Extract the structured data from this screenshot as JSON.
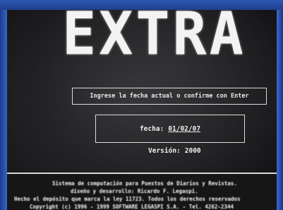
{
  "app": {
    "logo": "EXTRA"
  },
  "prompt": {
    "text": "Ingrese la fecha actual o confirme con Enter"
  },
  "date_field": {
    "label": "fecha:",
    "value": "01/02/07"
  },
  "version": {
    "label": "Versión:",
    "value": "2000"
  },
  "footer": {
    "line1": "Sistema de computación para Puestos de Diarios y Revistas.",
    "line2": "diseño y desarrollo: Ricardo F. Legaspi.",
    "line3": "Hecho el depósito que marca la ley 11723. Todos los derechos reservados",
    "line4": "Copyright (c) 1996 - 1999 SOFTWARE LEGASPI S.A. - Tel. 4262-2344"
  }
}
